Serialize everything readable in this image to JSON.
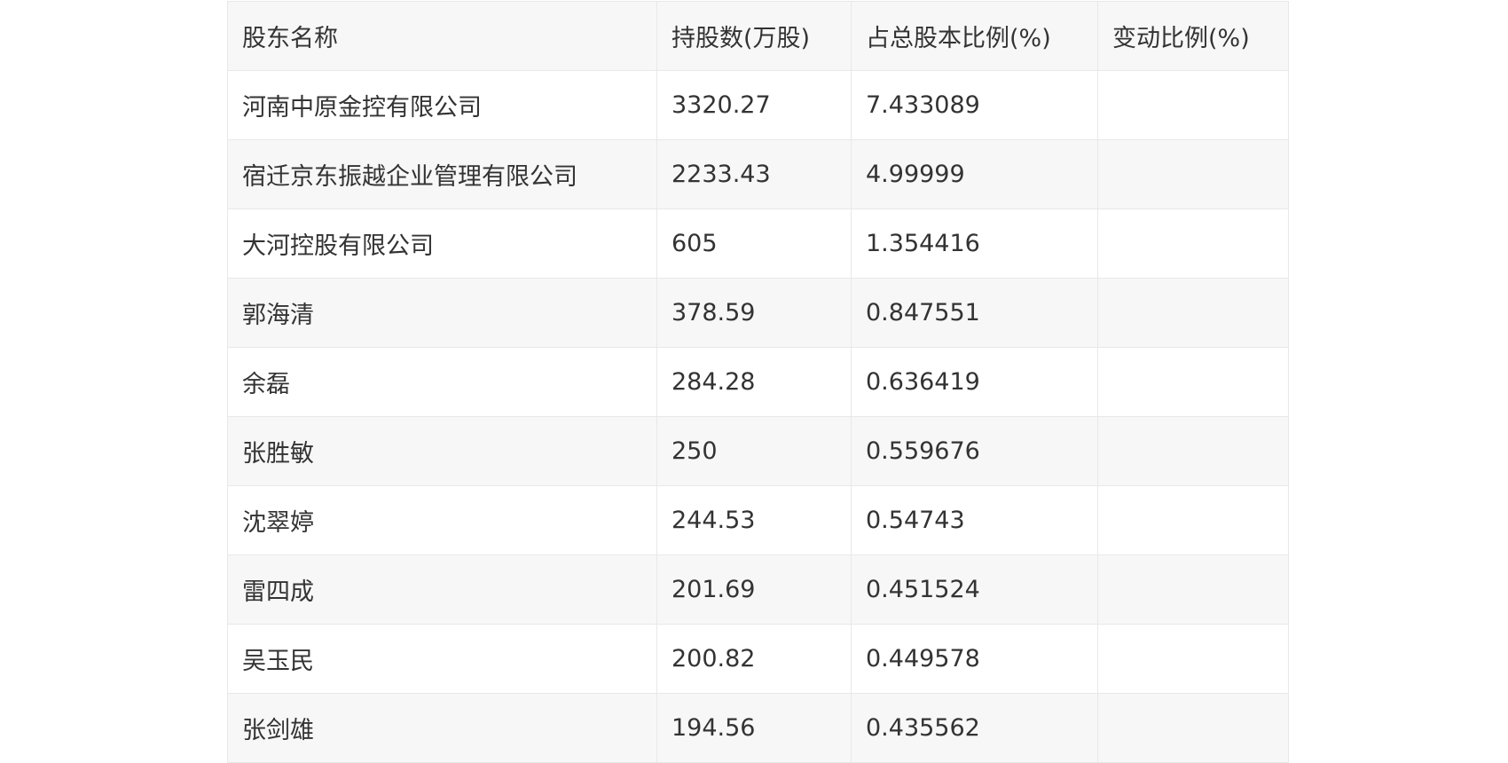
{
  "table": {
    "headers": [
      "股东名称",
      "持股数(万股)",
      "占总股本比例(%)",
      "变动比例(%)"
    ],
    "rows": [
      [
        "河南中原金控有限公司",
        "3320.27",
        "7.433089",
        ""
      ],
      [
        "宿迁京东振越企业管理有限公司",
        "2233.43",
        "4.99999",
        ""
      ],
      [
        "大河控股有限公司",
        "605",
        "1.354416",
        ""
      ],
      [
        "郭海清",
        "378.59",
        "0.847551",
        ""
      ],
      [
        "余磊",
        "284.28",
        "0.636419",
        ""
      ],
      [
        "张胜敏",
        "250",
        "0.559676",
        ""
      ],
      [
        "沈翠婷",
        "244.53",
        "0.54743",
        ""
      ],
      [
        "雷四成",
        "201.69",
        "0.451524",
        ""
      ],
      [
        "吴玉民",
        "200.82",
        "0.449578",
        ""
      ],
      [
        "张剑雄",
        "194.56",
        "0.435562",
        ""
      ]
    ]
  }
}
